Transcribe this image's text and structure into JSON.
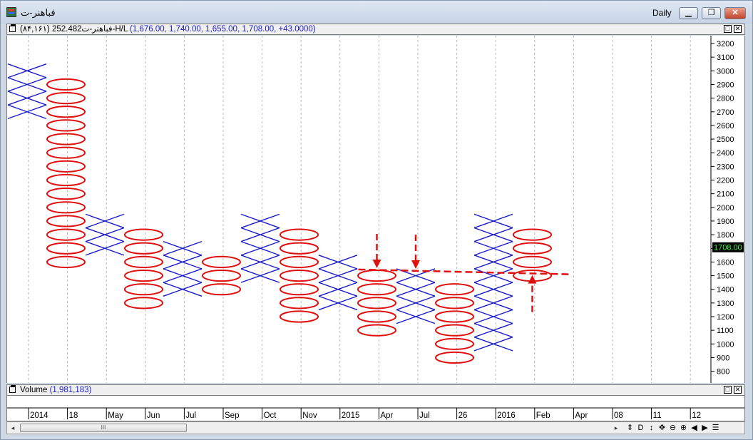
{
  "window": {
    "title": "فباهنر-ت",
    "period": "Daily",
    "buttons": {
      "minimize": "▁",
      "restore": "❐",
      "close": "✕"
    }
  },
  "price_pane": {
    "name_prefix": "(۸۴,۱۶۱) فباهنر-ت",
    "name_prefix_icon": "chart-pane-icon",
    "params": "252.482-H/L",
    "ohlc_text": "(1,676.00, 1,740.00, 1,655.00, 1,708.00, +43.0000)",
    "last_price_label": "1708.00"
  },
  "volume_pane": {
    "label": "Volume",
    "value": "(1,981,183)"
  },
  "scrollbar": {
    "thumb_label": "III"
  },
  "nav_tools": [
    "⇕",
    "D",
    "↕",
    "✥",
    "⊖",
    "⊕",
    "◀",
    "▶",
    "☰"
  ],
  "colors": {
    "x_color": "#1a1acc",
    "o_color": "#e01010",
    "annotation": "#e01010",
    "last_price_bg": "#000000",
    "last_price_fg": "#33ff33"
  },
  "chart_data": {
    "type": "point-and-figure",
    "box_size": 100,
    "ylim": [
      750,
      3250
    ],
    "yticks": [
      800,
      900,
      1000,
      1100,
      1200,
      1300,
      1400,
      1500,
      1600,
      1700,
      1800,
      1900,
      2000,
      2100,
      2200,
      2300,
      2400,
      2500,
      2600,
      2700,
      2800,
      2900,
      3000,
      3100,
      3200
    ],
    "grid": true,
    "columns": [
      {
        "type": "X",
        "low": 2700,
        "high": 3000
      },
      {
        "type": "O",
        "low": 1600,
        "high": 2900
      },
      {
        "type": "X",
        "low": 1700,
        "high": 1900
      },
      {
        "type": "O",
        "low": 1300,
        "high": 1800
      },
      {
        "type": "X",
        "low": 1400,
        "high": 1700
      },
      {
        "type": "O",
        "low": 1400,
        "high": 1600
      },
      {
        "type": "X",
        "low": 1500,
        "high": 1900
      },
      {
        "type": "O",
        "low": 1200,
        "high": 1800
      },
      {
        "type": "X",
        "low": 1300,
        "high": 1600
      },
      {
        "type": "O",
        "low": 1100,
        "high": 1500
      },
      {
        "type": "X",
        "low": 1200,
        "high": 1500
      },
      {
        "type": "O",
        "low": 900,
        "high": 1400
      },
      {
        "type": "X",
        "low": 1000,
        "high": 1900
      },
      {
        "type": "O",
        "low": 1500,
        "high": 1800
      }
    ],
    "x_labels": [
      "2014",
      "18",
      "May",
      "Jun",
      "Jul",
      "Sep",
      "Oct",
      "Nov",
      "2015",
      "Apr",
      "Jul",
      "26",
      "2016",
      "Feb",
      "Apr",
      "08",
      "11",
      "12"
    ],
    "annotations": {
      "resistance_line": {
        "from_col": 9,
        "to_col": 14,
        "y_start": 1545,
        "y_end": 1510
      },
      "arrows": [
        {
          "col": 9,
          "direction": "down",
          "target": 1555
        },
        {
          "col": 10,
          "direction": "down",
          "target": 1550
        },
        {
          "col": 13,
          "direction": "up",
          "target": 1505
        }
      ]
    }
  }
}
